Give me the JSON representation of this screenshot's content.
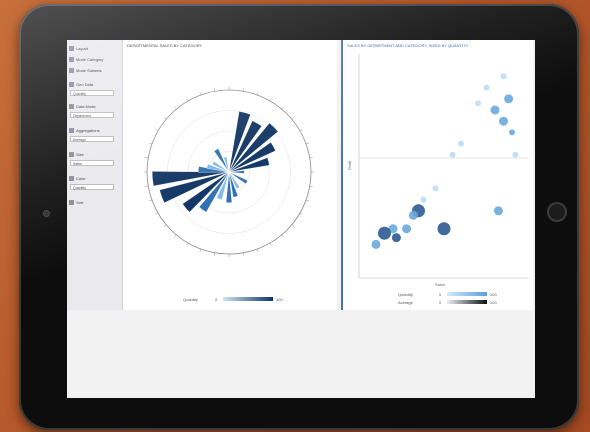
{
  "sidebar": {
    "items": [
      {
        "label": "Layout"
      },
      {
        "label": "Mode Category"
      },
      {
        "label": "Mode Subsets"
      },
      {
        "label": "Geo Data"
      },
      {
        "label": "Data Mode"
      },
      {
        "label": "Aggregations"
      },
      {
        "label": "Size"
      },
      {
        "label": "Color"
      },
      {
        "label": "Sort"
      }
    ],
    "inputs": [
      {
        "value": "Quantity"
      },
      {
        "value": "Department"
      },
      {
        "value": "Average"
      },
      {
        "value": "Sales"
      },
      {
        "value": "Quantity"
      }
    ]
  },
  "left_chart": {
    "title": "DEPARTMENTAL SALES BY CATEGORY",
    "legend_label": "Quantity",
    "legend_min": "0",
    "legend_max": "100"
  },
  "right_chart": {
    "title": "SALES BY DEPARTMENT AND CATEGORY, SIZED BY QUANTITY",
    "x_label": "Sales",
    "y_label": "Profit",
    "legend_rows": [
      {
        "label": "Quantity",
        "min": "0",
        "max": "100"
      },
      {
        "label": "Average",
        "min": "0",
        "max": "100"
      }
    ]
  },
  "colors": {
    "accent": "#2b57b5",
    "dark_bar": "#0f3462",
    "mid_bar": "#2e6fb2",
    "light_bar": "#7fb8e8"
  },
  "chart_data": [
    {
      "type": "bar",
      "polar": true,
      "title": "DEPARTMENTAL SALES BY CATEGORY",
      "angles_deg": [
        15,
        30,
        45,
        60,
        75,
        90,
        120,
        150,
        165,
        180,
        200,
        215,
        230,
        250,
        265,
        275,
        285,
        300,
        330,
        345
      ],
      "values": [
        60,
        55,
        62,
        50,
        40,
        15,
        20,
        18,
        25,
        30,
        28,
        45,
        55,
        70,
        75,
        30,
        22,
        18,
        25,
        15
      ],
      "shade": [
        2,
        2,
        2,
        2,
        2,
        1,
        1,
        0,
        1,
        1,
        0,
        1,
        2,
        2,
        2,
        1,
        0,
        0,
        1,
        0
      ]
    },
    {
      "type": "scatter",
      "title": "SALES BY DEPARTMENT AND CATEGORY, SIZED BY QUANTITY",
      "xlim": [
        0,
        100
      ],
      "ylim": [
        0,
        100
      ],
      "points": [
        {
          "x": 35,
          "y": 30,
          "size": 3,
          "shade": 2
        },
        {
          "x": 32,
          "y": 28,
          "size": 2,
          "shade": 1
        },
        {
          "x": 28,
          "y": 22,
          "size": 2,
          "shade": 1
        },
        {
          "x": 20,
          "y": 22,
          "size": 2,
          "shade": 1
        },
        {
          "x": 15,
          "y": 20,
          "size": 3,
          "shade": 2
        },
        {
          "x": 10,
          "y": 15,
          "size": 2,
          "shade": 1
        },
        {
          "x": 22,
          "y": 18,
          "size": 2,
          "shade": 2
        },
        {
          "x": 50,
          "y": 22,
          "size": 3,
          "shade": 2
        },
        {
          "x": 45,
          "y": 40,
          "size": 1,
          "shade": 0
        },
        {
          "x": 38,
          "y": 35,
          "size": 1,
          "shade": 0
        },
        {
          "x": 60,
          "y": 60,
          "size": 1,
          "shade": 0
        },
        {
          "x": 55,
          "y": 55,
          "size": 1,
          "shade": 0
        },
        {
          "x": 80,
          "y": 75,
          "size": 2,
          "shade": 1
        },
        {
          "x": 85,
          "y": 70,
          "size": 2,
          "shade": 1
        },
        {
          "x": 88,
          "y": 80,
          "size": 2,
          "shade": 1
        },
        {
          "x": 90,
          "y": 65,
          "size": 1,
          "shade": 1
        },
        {
          "x": 92,
          "y": 55,
          "size": 1,
          "shade": 0
        },
        {
          "x": 70,
          "y": 78,
          "size": 1,
          "shade": 0
        },
        {
          "x": 75,
          "y": 85,
          "size": 1,
          "shade": 0
        },
        {
          "x": 85,
          "y": 90,
          "size": 1,
          "shade": 0
        },
        {
          "x": 82,
          "y": 30,
          "size": 2,
          "shade": 1
        }
      ]
    }
  ]
}
